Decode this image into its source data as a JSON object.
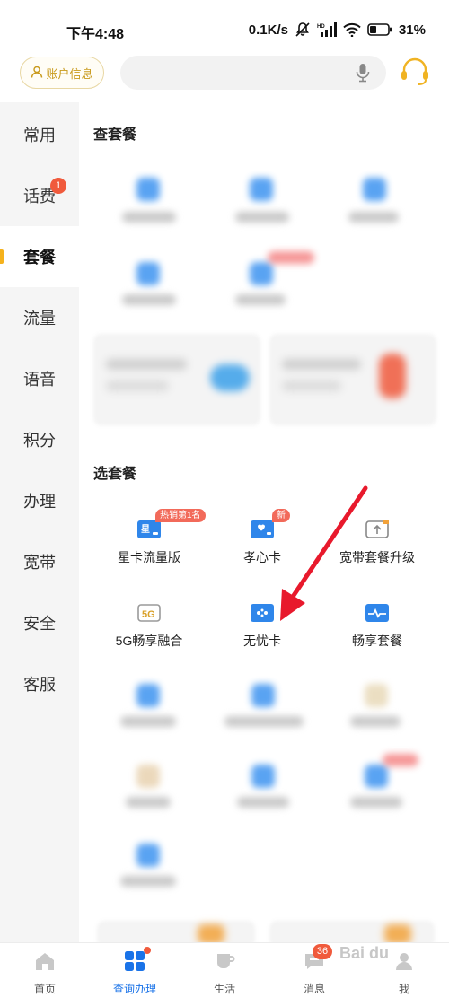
{
  "status_bar": {
    "time": "下午4:48",
    "speed": "0.1K/s",
    "battery": "31%"
  },
  "header": {
    "account_label": "账户信息",
    "search_placeholder": ""
  },
  "sidebar": {
    "items": [
      {
        "label": "常用"
      },
      {
        "label": "话费",
        "badge": "1"
      },
      {
        "label": "套餐",
        "active": true
      },
      {
        "label": "流量"
      },
      {
        "label": "语音"
      },
      {
        "label": "积分"
      },
      {
        "label": "办理"
      },
      {
        "label": "宽带"
      },
      {
        "label": "安全"
      },
      {
        "label": "客服"
      }
    ]
  },
  "sections": {
    "query_title": "查套餐",
    "choose_title": "选套餐"
  },
  "packages": [
    {
      "label": "星卡流量版",
      "tag": "热销第1名",
      "icon": "star-card-icon"
    },
    {
      "label": "孝心卡",
      "tag": "新",
      "icon": "heart-card-icon"
    },
    {
      "label": "宽带套餐升级",
      "icon": "upgrade-icon"
    },
    {
      "label": "5G畅享融合",
      "icon": "5g-icon",
      "icon_text": "5G"
    },
    {
      "label": "无忧卡",
      "icon": "gamepad-card-icon"
    },
    {
      "label": "畅享套餐",
      "icon": "pulse-card-icon"
    }
  ],
  "bottom_nav": {
    "items": [
      {
        "label": "首页",
        "icon": "home-icon"
      },
      {
        "label": "查询办理",
        "icon": "grid-icon",
        "active": true,
        "dot": true
      },
      {
        "label": "生活",
        "icon": "cup-icon"
      },
      {
        "label": "消息",
        "icon": "message-icon",
        "badge": "36"
      },
      {
        "label": "我",
        "icon": "user-icon"
      }
    ]
  },
  "watermark": "Bai du",
  "colors": {
    "accent_blue": "#1a73e8",
    "icon_blue": "#2f86ea",
    "tag_red": "#f26a5a",
    "gold": "#c99a1c",
    "arrow_red": "#e8192c"
  }
}
